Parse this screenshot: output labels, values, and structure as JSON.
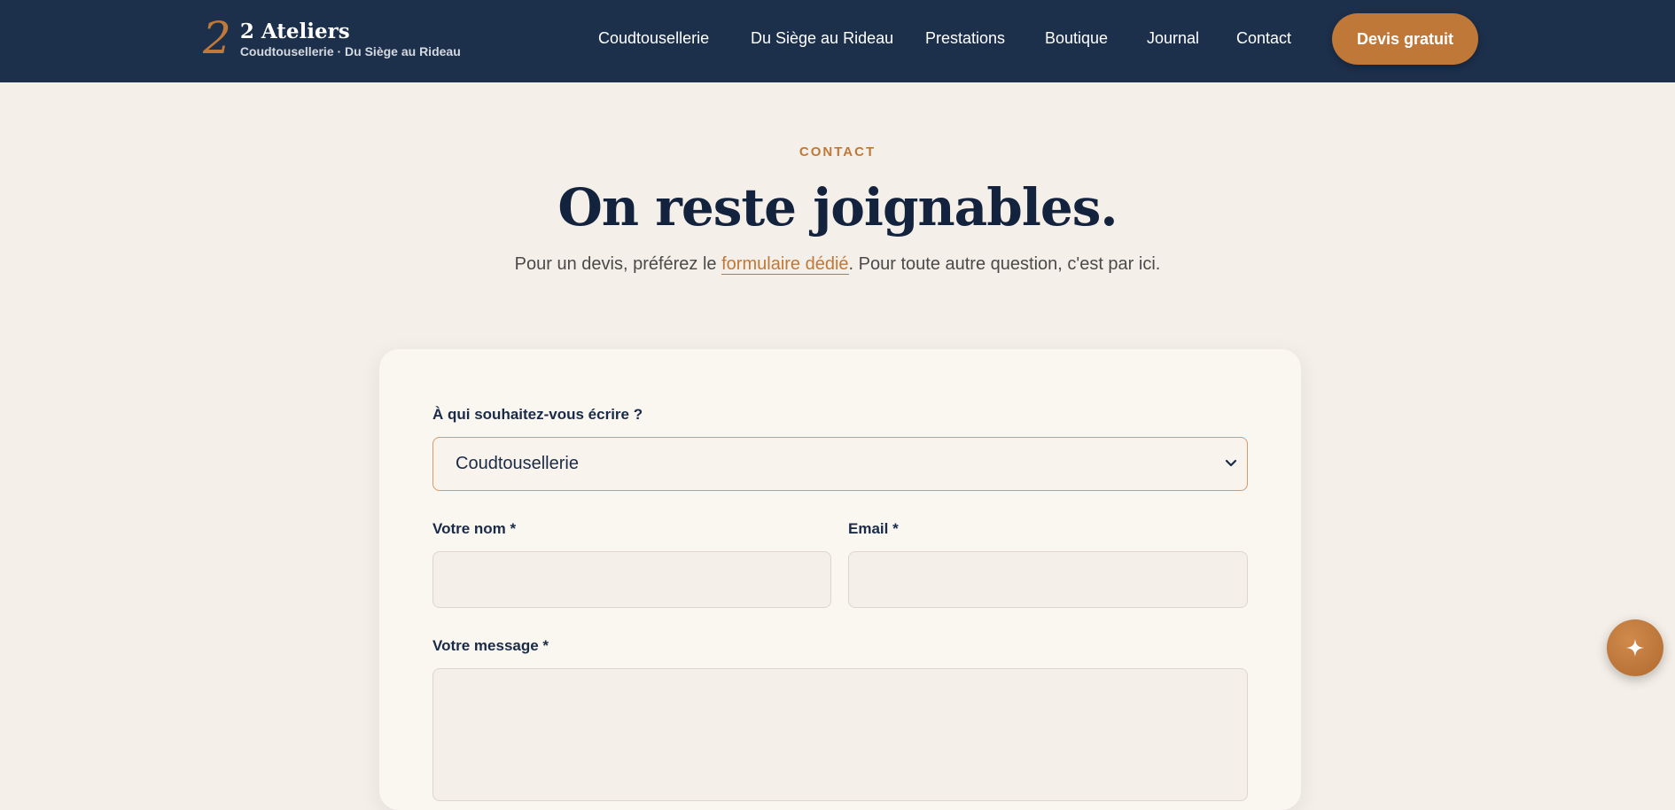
{
  "brand": {
    "mark": "2",
    "title": "2 Ateliers",
    "subtitle": "Coudtousellerie · Du Siège au Rideau"
  },
  "nav": {
    "items": [
      {
        "label": "Coudtousellerie"
      },
      {
        "label": "Du Siège au Rideau"
      },
      {
        "label": "Prestations"
      },
      {
        "label": "Boutique"
      },
      {
        "label": "Journal"
      },
      {
        "label": "Contact"
      }
    ],
    "cta_label": "Devis gratuit"
  },
  "hero": {
    "eyebrow": "CONTACT",
    "title": "On reste joignables.",
    "lead_before": "Pour un devis, préférez le ",
    "lead_link": "formulaire dédié",
    "lead_after": ". Pour toute autre question, c'est par ici."
  },
  "form": {
    "recipient_label": "À qui souhaitez-vous écrire ?",
    "recipient_value": "Coudtousellerie",
    "name_label": "Votre nom *",
    "name_value": "",
    "email_label": "Email *",
    "email_value": "",
    "message_label": "Votre message *",
    "message_value": ""
  },
  "colors": {
    "header_bg": "#1c2f4b",
    "accent": "#c07838",
    "page_bg": "#f4efe8",
    "card_bg": "#faf6f0"
  },
  "icons": {
    "select": "chevron-down-icon",
    "fab": "sparkle-icon"
  }
}
